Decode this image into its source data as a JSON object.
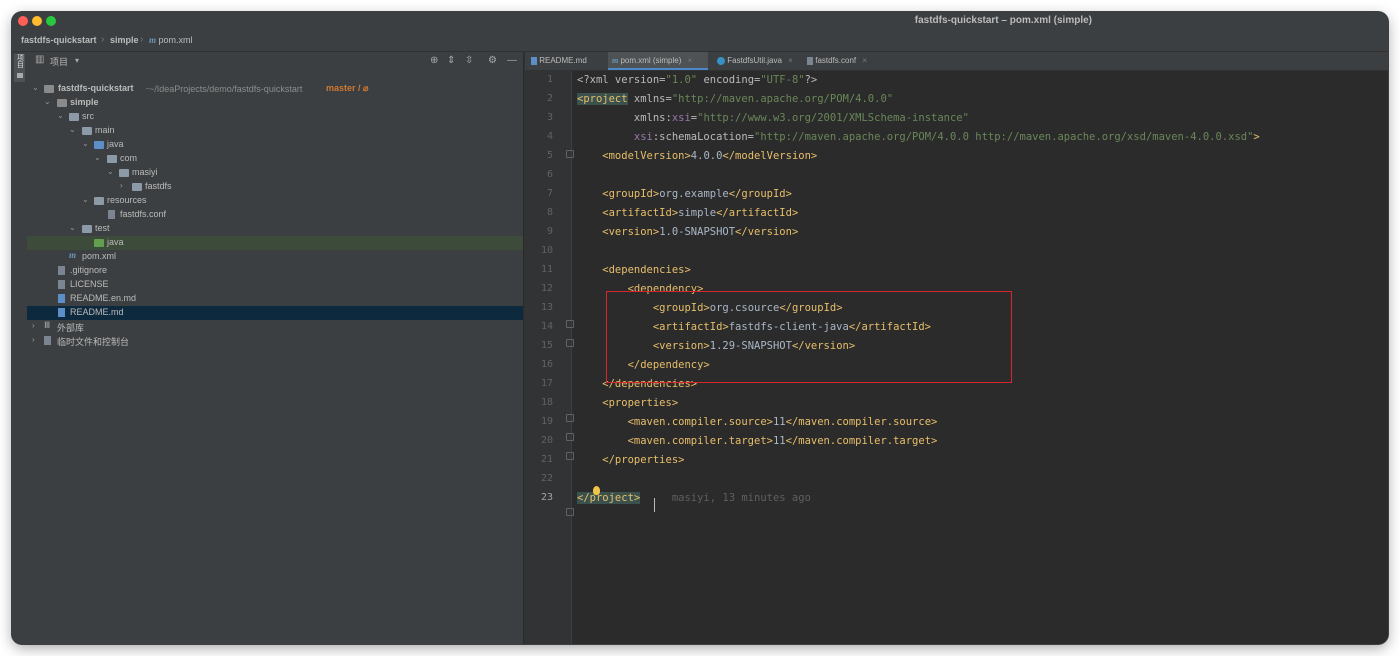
{
  "window": {
    "title": "fastdfs-quickstart – pom.xml (simple)"
  },
  "navbar": {
    "crumbs": [
      "fastdfs-quickstart",
      "simple",
      "pom.xml"
    ],
    "sep": "›"
  },
  "left_strip": {
    "label": "项目"
  },
  "project_panel": {
    "header_label": "项目",
    "tree": [
      {
        "label": "fastdfs-quickstart",
        "extra": "~/IdeaProjects/demo/fastdfs-quickstart",
        "branch": "master / ⌀"
      },
      {
        "label": "simple"
      },
      {
        "label": "src"
      },
      {
        "label": "main"
      },
      {
        "label": "java"
      },
      {
        "label": "com"
      },
      {
        "label": "masiyi"
      },
      {
        "label": "fastdfs"
      },
      {
        "label": "resources"
      },
      {
        "label": "fastdfs.conf"
      },
      {
        "label": "test"
      },
      {
        "label": "java"
      },
      {
        "label": "pom.xml"
      },
      {
        "label": ".gitignore"
      },
      {
        "label": "LICENSE"
      },
      {
        "label": "README.en.md"
      },
      {
        "label": "README.md"
      },
      {
        "label": "外部库"
      },
      {
        "label": "临时文件和控制台"
      }
    ]
  },
  "editor": {
    "tabs": [
      {
        "label": "README.md"
      },
      {
        "label": "pom.xml (simple)"
      },
      {
        "label": "FastdfsUtil.java"
      },
      {
        "label": "fastdfs.conf"
      }
    ],
    "line_numbers": [
      "1",
      "2",
      "3",
      "4",
      "5",
      "6",
      "7",
      "8",
      "9",
      "10",
      "11",
      "12",
      "13",
      "14",
      "15",
      "16",
      "17",
      "18",
      "19",
      "20",
      "21",
      "22",
      "23"
    ],
    "code": {
      "l1": {
        "p1": "<?xml version=",
        "p2": "\"1.0\"",
        "p3": " encoding=",
        "p4": "\"UTF-8\"",
        "p5": "?>"
      },
      "l2": {
        "p1": "<project",
        "p2": " xmlns=",
        "p3": "\"http://maven.apache.org/POM/4.0.0\""
      },
      "l3": {
        "p1": "         xmlns:",
        "p2": "xsi",
        "p3": "=",
        "p4": "\"http://www.w3.org/2001/XMLSchema-instance\""
      },
      "l4": {
        "p1": "         xsi",
        "p2": ":schemaLocation=",
        "p3": "\"http://maven.apache.org/POM/4.0.0 http://maven.apache.org/xsd/maven-4.0.0.xsd\"",
        "p4": ">"
      },
      "l5": {
        "p1": "    <modelVersion>",
        "p2": "4.0.0",
        "p3": "</modelVersion>"
      },
      "l7": {
        "p1": "    <groupId>",
        "p2": "org.example",
        "p3": "</groupId>"
      },
      "l8": {
        "p1": "    <artifactId>",
        "p2": "simple",
        "p3": "</artifactId>"
      },
      "l9": {
        "p1": "    <version>",
        "p2": "1.0-SNAPSHOT",
        "p3": "</version>"
      },
      "l11": {
        "p1": "    <dependencies>"
      },
      "l12": {
        "p1": "        <dependency>"
      },
      "l13": {
        "p1": "            <groupId>",
        "p2": "org.csource",
        "p3": "</groupId>"
      },
      "l14": {
        "p1": "            <artifactId>",
        "p2": "fastdfs-client-java",
        "p3": "</artifactId>"
      },
      "l15": {
        "p1": "            <version>",
        "p2": "1.29-SNAPSHOT",
        "p3": "</version>"
      },
      "l16": {
        "p1": "        </dependency>"
      },
      "l17": {
        "p1": "    </dependencies>"
      },
      "l18": {
        "p1": "    <properties>"
      },
      "l19": {
        "p1": "        <maven.compiler.source>",
        "p2": "11",
        "p3": "</maven.compiler.source>"
      },
      "l20": {
        "p1": "        <maven.compiler.target>",
        "p2": "11",
        "p3": "</maven.compiler.target>"
      },
      "l21": {
        "p1": "    </properties>"
      },
      "l23": {
        "p1": "</project>",
        "hint": "     masiyi, 13 minutes ago"
      }
    }
  },
  "colors": {
    "accent": "#4a88c7",
    "highlight_box": "#d8262f",
    "tag": "#e8bf6a",
    "string": "#6a8759"
  }
}
